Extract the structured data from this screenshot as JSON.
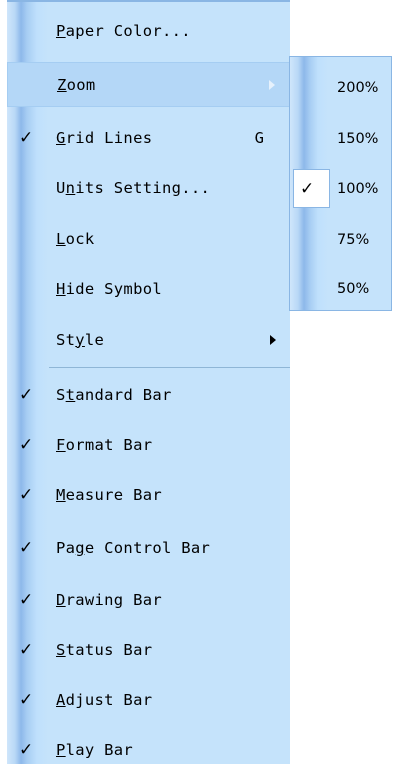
{
  "menu": {
    "items": [
      {
        "name": "paper-color",
        "pre": "",
        "ul": "P",
        "post": "aper Color...",
        "checked": false,
        "shortcut": "",
        "submenu": false,
        "highlight": false
      },
      {
        "name": "zoom",
        "pre": "",
        "ul": "Z",
        "post": "oom",
        "checked": false,
        "shortcut": "",
        "submenu": true,
        "highlight": true
      },
      {
        "name": "grid-lines",
        "pre": "",
        "ul": "G",
        "post": "rid Lines",
        "checked": true,
        "shortcut": "G",
        "submenu": false,
        "highlight": false
      },
      {
        "name": "units-setting",
        "pre": "U",
        "ul": "n",
        "post": "its Setting...",
        "checked": false,
        "shortcut": "",
        "submenu": false,
        "highlight": false
      },
      {
        "name": "lock",
        "pre": "",
        "ul": "L",
        "post": "ock",
        "checked": false,
        "shortcut": "",
        "submenu": false,
        "highlight": false
      },
      {
        "name": "hide-symbol",
        "pre": "",
        "ul": "H",
        "post": "ide Symbol",
        "checked": false,
        "shortcut": "",
        "submenu": false,
        "highlight": false
      },
      {
        "name": "style",
        "pre": "St",
        "ul": "y",
        "post": "le",
        "checked": false,
        "shortcut": "",
        "submenu": true,
        "highlight": false
      },
      {
        "name": "standard-bar",
        "pre": "S",
        "ul": "t",
        "post": "andard Bar",
        "checked": true,
        "shortcut": "",
        "submenu": false,
        "highlight": false
      },
      {
        "name": "format-bar",
        "pre": "",
        "ul": "F",
        "post": "ormat Bar",
        "checked": true,
        "shortcut": "",
        "submenu": false,
        "highlight": false
      },
      {
        "name": "measure-bar",
        "pre": "",
        "ul": "M",
        "post": "easure Bar",
        "checked": true,
        "shortcut": "",
        "submenu": false,
        "highlight": false
      },
      {
        "name": "page-control-bar",
        "pre": "Pa",
        "ul": "g",
        "post": "e Control Bar",
        "checked": true,
        "shortcut": "",
        "submenu": false,
        "highlight": false
      },
      {
        "name": "drawing-bar",
        "pre": "",
        "ul": "D",
        "post": "rawing Bar",
        "checked": true,
        "shortcut": "",
        "submenu": false,
        "highlight": false
      },
      {
        "name": "status-bar",
        "pre": "",
        "ul": "S",
        "post": "tatus Bar",
        "checked": true,
        "shortcut": "",
        "submenu": false,
        "highlight": false
      },
      {
        "name": "adjust-bar",
        "pre": "",
        "ul": "A",
        "post": "djust Bar",
        "checked": true,
        "shortcut": "",
        "submenu": false,
        "highlight": false
      },
      {
        "name": "play-bar",
        "pre": "",
        "ul": "P",
        "post": "lay Bar",
        "checked": true,
        "shortcut": "",
        "submenu": false,
        "highlight": false
      }
    ]
  },
  "zoom_submenu": {
    "items": [
      {
        "label": "200%",
        "checked": false
      },
      {
        "label": "150%",
        "checked": false
      },
      {
        "label": "100%",
        "checked": true
      },
      {
        "label": "75%",
        "checked": false
      },
      {
        "label": "50%",
        "checked": false
      }
    ]
  },
  "glyphs": {
    "check": "✓"
  },
  "colors": {
    "menu_bg": "#c5e3fb",
    "highlight": "#b4d7f7",
    "gutter": "#8db8ea",
    "separator": "#8fb6d6",
    "arrow_dim": "#e6f1fc",
    "arrow": "#000000"
  }
}
